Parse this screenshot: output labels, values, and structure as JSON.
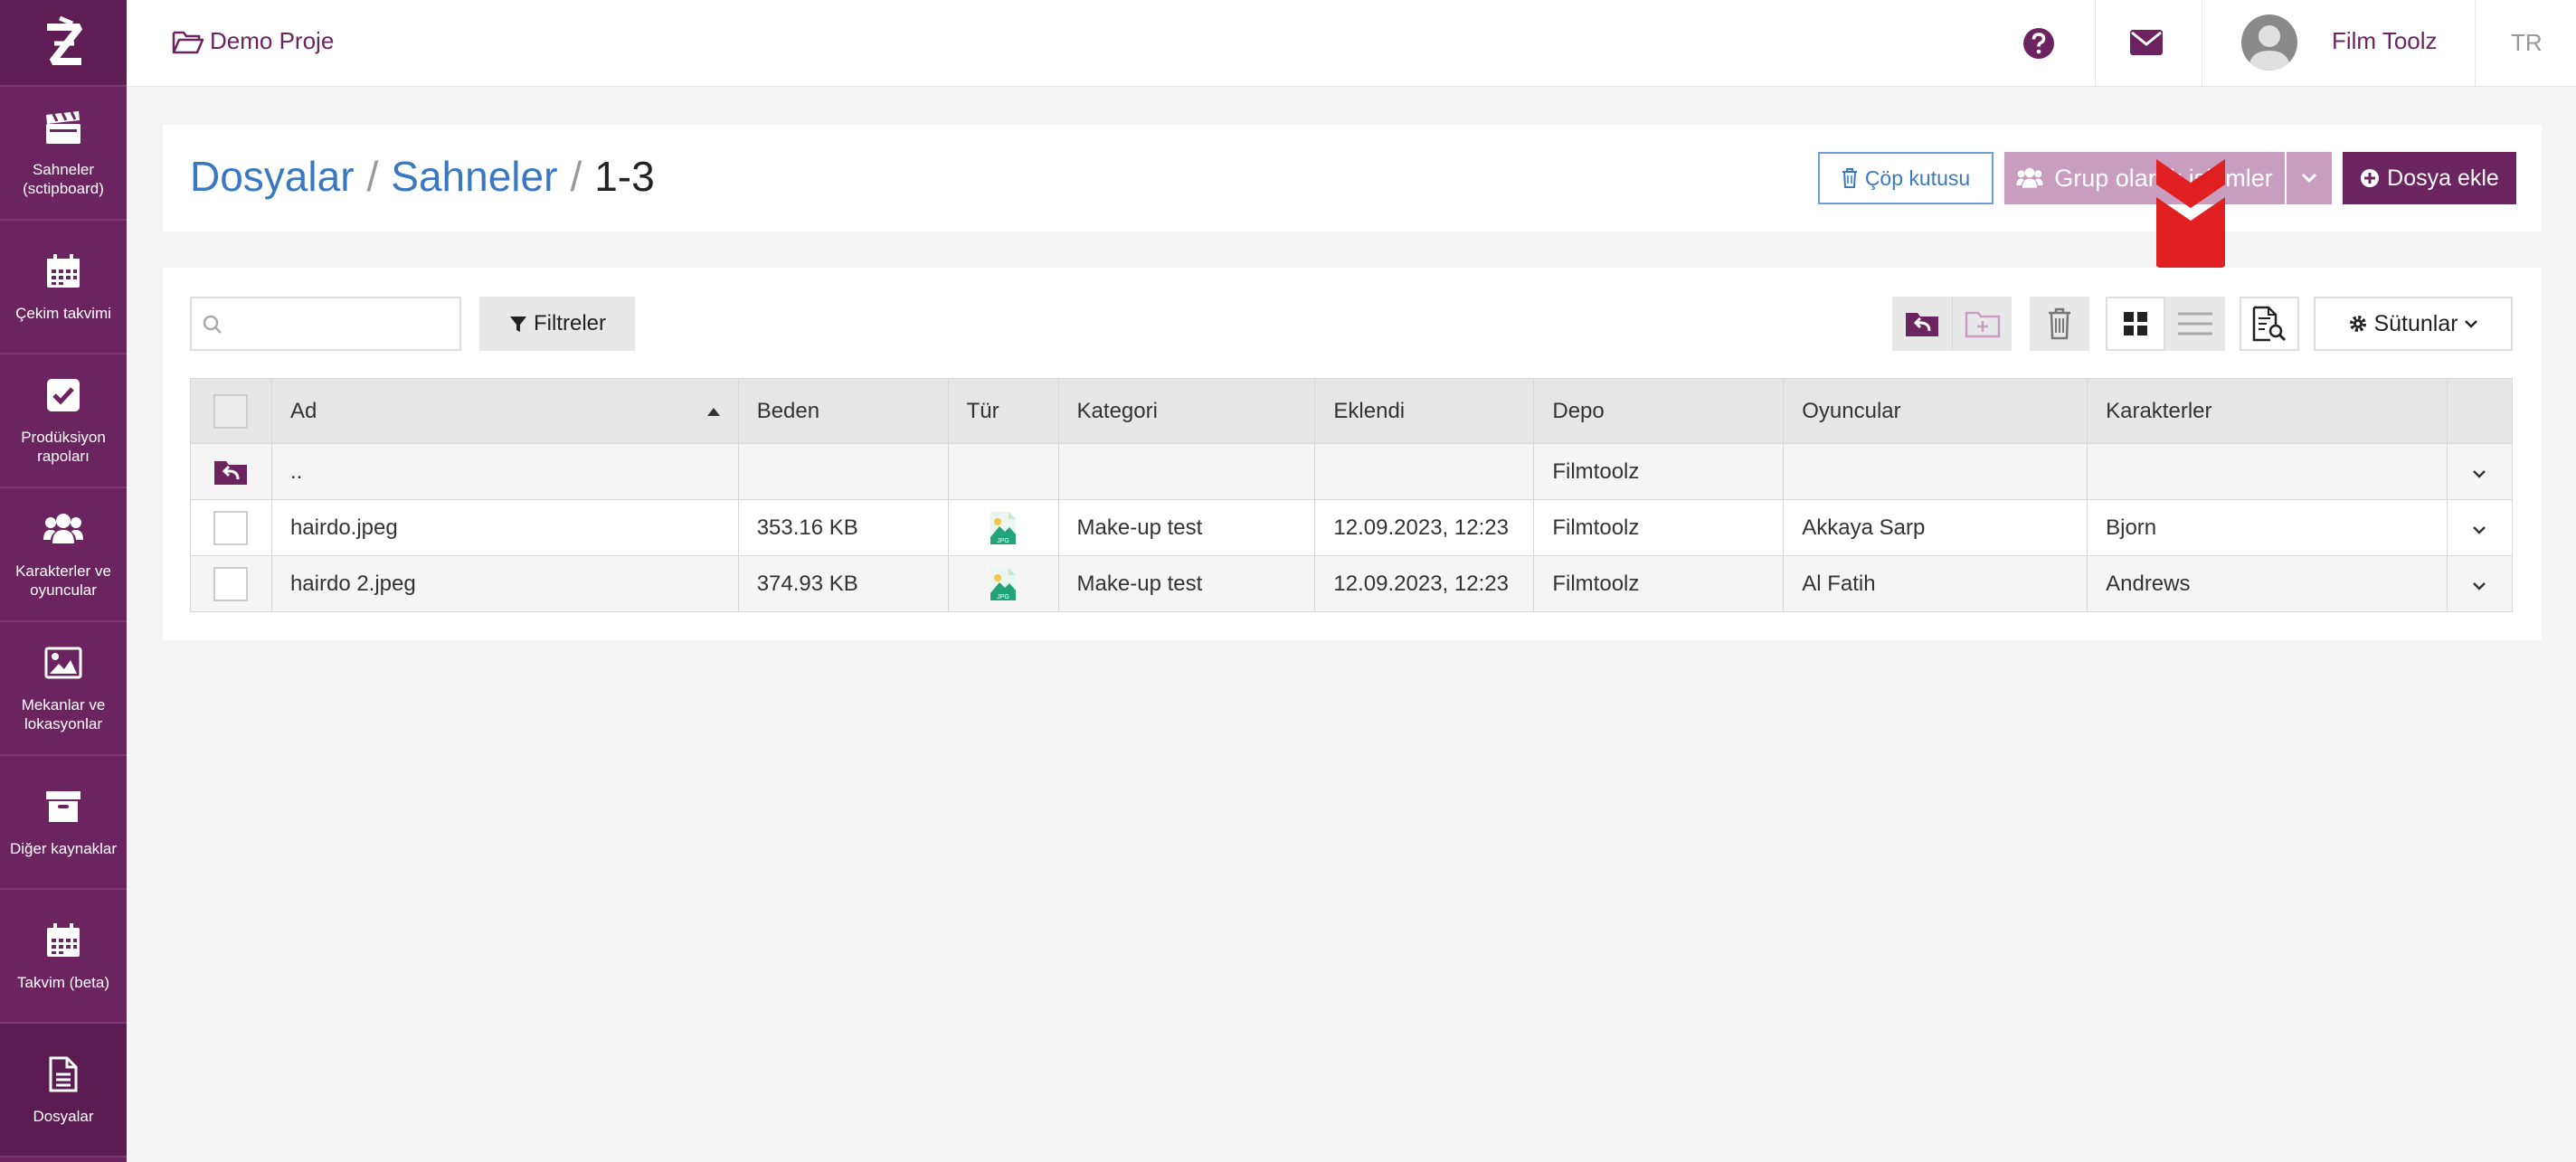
{
  "sidebar": {
    "items": [
      {
        "label": "Sahneler (sctipboard)",
        "icon": "clapperboard-icon"
      },
      {
        "label": "Çekim takvimi",
        "icon": "calendar-icon"
      },
      {
        "label": "Prodüksiyon rapoları",
        "icon": "checkbox-icon"
      },
      {
        "label": "Karakterler ve oyuncular",
        "icon": "users-icon"
      },
      {
        "label": "Mekanlar ve lokasyonlar",
        "icon": "image-icon"
      },
      {
        "label": "Diğer kaynaklar",
        "icon": "archive-icon"
      },
      {
        "label": "Takvim (beta)",
        "icon": "calendar-icon"
      },
      {
        "label": "Dosyalar",
        "icon": "document-icon"
      }
    ]
  },
  "topbar": {
    "project": "Demo Proje",
    "user": "Film Toolz",
    "lang": "TR"
  },
  "header": {
    "breadcrumb": [
      "Dosyalar",
      "Sahneler",
      "1-3"
    ],
    "trash": "Çöp kutusu",
    "group_actions": "Grup olarak işlemler",
    "add_file": "Dosya ekle"
  },
  "toolbar": {
    "search_placeholder": "",
    "filters": "Filtreler",
    "columns": "Sütunlar"
  },
  "table": {
    "headers": [
      "Ad",
      "Beden",
      "Tür",
      "Kategori",
      "Eklendi",
      "Depo",
      "Oyuncular",
      "Karakterler"
    ],
    "parent_row": {
      "name": "..",
      "depo": "Filmtoolz"
    },
    "rows": [
      {
        "name": "hairdo.jpeg",
        "size": "353.16 KB",
        "type": "JPG",
        "category": "Make-up test",
        "added": "12.09.2023, 12:23",
        "depo": "Filmtoolz",
        "actors": "Akkaya Sarp",
        "characters": "Bjorn"
      },
      {
        "name": "hairdo 2.jpeg",
        "size": "374.93 KB",
        "type": "JPG",
        "category": "Make-up test",
        "added": "12.09.2023, 12:23",
        "depo": "Filmtoolz",
        "actors": "Al Fatih",
        "characters": "Andrews"
      }
    ]
  },
  "colors": {
    "brand": "#6b2460",
    "link": "#3b78c2",
    "marker": "#e02020"
  }
}
